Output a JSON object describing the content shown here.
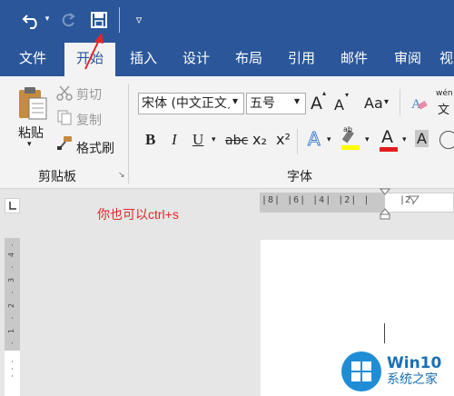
{
  "quick_access": {
    "customize_symbol": "▿"
  },
  "tabs": [
    {
      "label": "文件"
    },
    {
      "label": "开始"
    },
    {
      "label": "插入"
    },
    {
      "label": "设计"
    },
    {
      "label": "布局"
    },
    {
      "label": "引用"
    },
    {
      "label": "邮件"
    },
    {
      "label": "审阅"
    },
    {
      "label": "视"
    }
  ],
  "clipboard": {
    "paste_label": "粘贴",
    "cut_label": "剪切",
    "copy_label": "复制",
    "format_painter_label": "格式刷",
    "group_label": "剪贴板"
  },
  "font": {
    "font_name": "宋体 (中文正文)",
    "font_size": "五号",
    "grow_label": "A",
    "shrink_label": "A",
    "case_label": "Aa",
    "bold_label": "B",
    "italic_label": "I",
    "underline_label": "U",
    "strike_label": "abc",
    "subscript_label": "x₂",
    "superscript_label": "x²",
    "effects_label": "A",
    "highlight_label": "ab",
    "color_label": "A",
    "shade_label": "A",
    "wen_label": "wén",
    "wen_char": "文",
    "group_label": "字体",
    "colors": {
      "highlight": "#ffff00",
      "font_color": "#e31c1c",
      "effects": "#3d7cc9"
    }
  },
  "ruler": {
    "numbers": "|8| |6| |4| |2| |",
    "numbers_right": "|2|"
  },
  "annotation": "你也可以ctrl+s",
  "watermark": {
    "title": "Win10",
    "subtitle": "系统之家"
  },
  "colors": {
    "brand": "#2b579a",
    "ribbon_bg": "#f3f3f3"
  }
}
